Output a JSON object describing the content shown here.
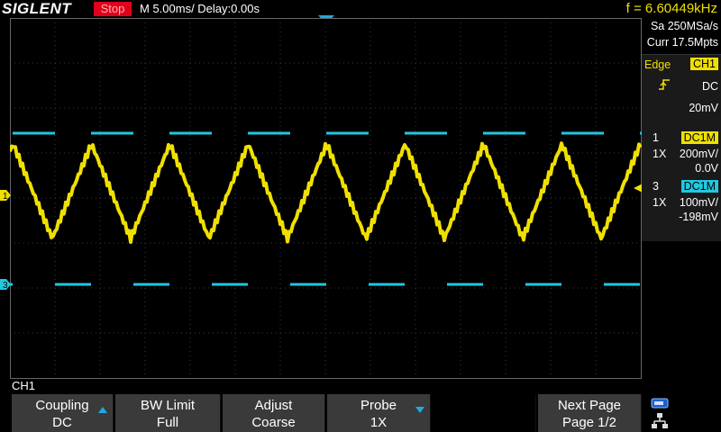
{
  "header": {
    "brand": "SIGLENT",
    "run_status": "Stop",
    "timebase": "M 5.00ms/ Delay:0.00s",
    "frequency": "f = 6.60449kHz"
  },
  "acquisition": {
    "sample_rate": "Sa 250MSa/s",
    "memory_depth": "Curr 17.5Mpts"
  },
  "trigger": {
    "type": "Edge",
    "source": "CH1",
    "coupling": "DC",
    "level": "20mV",
    "slope_icon": "rising-edge-icon"
  },
  "channels": [
    {
      "number": "1",
      "coupling": "DC1M",
      "probe": "1X",
      "scale": "200mV/",
      "offset": "0.0V",
      "color": "#f0e000"
    },
    {
      "number": "3",
      "coupling": "DC1M",
      "probe": "1X",
      "scale": "100mV/",
      "offset": "-198mV",
      "color": "#21c8e0"
    }
  ],
  "markers": {
    "ch1": "1",
    "ch3": "3"
  },
  "active_channel_label": "CH1",
  "softkeys": [
    {
      "title": "Coupling",
      "value": "DC",
      "icon": "arrow-up-icon"
    },
    {
      "title": "BW Limit",
      "value": "Full",
      "icon": ""
    },
    {
      "title": "Adjust",
      "value": "Coarse",
      "icon": ""
    },
    {
      "title": "Probe",
      "value": "1X",
      "icon": "arrow-down-icon"
    },
    {
      "title": "",
      "value": "",
      "icon": ""
    },
    {
      "title": "Next Page",
      "value": "Page 1/2",
      "icon": ""
    }
  ],
  "status_icons": [
    "usb-icon",
    "network-icon"
  ],
  "colors": {
    "ch1": "#f0e000",
    "ch3": "#21c8e0",
    "run_stop": "#e0001a",
    "accent": "#21a8e0"
  }
}
